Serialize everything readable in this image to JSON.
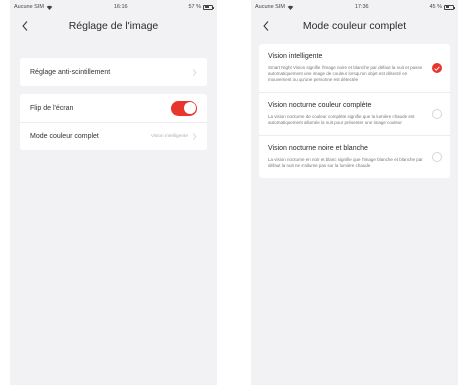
{
  "left": {
    "status": {
      "carrier": "Aucune SIM",
      "time": "16:16",
      "battery": "57 %",
      "battery_level": 0.57
    },
    "nav": {
      "title": "Réglage de l'image"
    },
    "rows": [
      {
        "label": "Réglage anti-scintillement",
        "value": ""
      },
      {
        "label": "Flip de l'écran",
        "toggle_on": true
      },
      {
        "label": "Mode couleur complet",
        "value": "Vision intelligente"
      }
    ]
  },
  "right": {
    "status": {
      "carrier": "Aucune SIM",
      "time": "17:36",
      "battery": "45 %",
      "battery_level": 0.45
    },
    "nav": {
      "title": "Mode couleur complet"
    },
    "options": [
      {
        "title": "Vision intelligente",
        "description": "Smart Night Vision signifie l'image noire et blanche par défaut la nuit et passe automatiquement une image de couleur lorsqu'un objet est détecté en mouvement ou qu'une personne est détectée",
        "selected": true
      },
      {
        "title": "Vision nocturne couleur complète",
        "description": "La vision nocturne de couleur complète signifie que la lumière chaude est automatiquement allumée la nuit pour présenter une image couleur",
        "selected": false
      },
      {
        "title": "Vision nocturne noire et blanche",
        "description": "La vision nocturne en noir et blanc signifie que l'image blanche et blanche par défaut la nuit ne s'allume pas sur la lumière chaude",
        "selected": false
      }
    ]
  },
  "colors": {
    "accent": "#e8352e",
    "background": "#f2f2f4"
  },
  "icons": [
    "back-chevron-icon",
    "chevron-right-icon",
    "wifi-icon",
    "battery-icon",
    "check-icon"
  ]
}
